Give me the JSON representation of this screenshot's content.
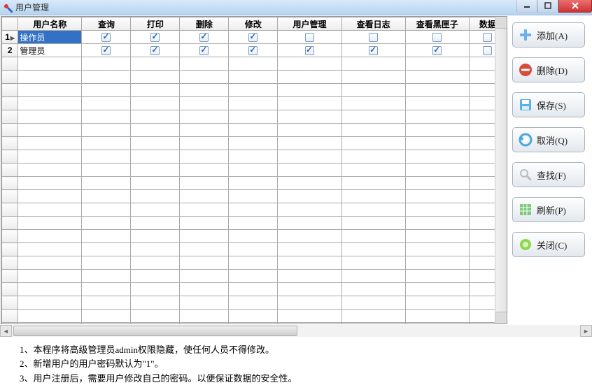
{
  "window": {
    "title": "用户管理"
  },
  "columns": [
    "用户名称",
    "查询",
    "打印",
    "删除",
    "修改",
    "用户管理",
    "查看日志",
    "查看黑匣子",
    "数据"
  ],
  "rows": [
    {
      "num": "1",
      "name": "操作员",
      "selected": true,
      "checks": {
        "查询": true,
        "打印": true,
        "删除": true,
        "修改": true,
        "用户管理": false,
        "查看日志": false,
        "查看黑匣子": false,
        "数据": false
      }
    },
    {
      "num": "2",
      "name": "管理员",
      "selected": false,
      "checks": {
        "查询": true,
        "打印": true,
        "删除": true,
        "修改": true,
        "用户管理": true,
        "查看日志": true,
        "查看黑匣子": true,
        "数据": false
      }
    }
  ],
  "buttons": {
    "add": "添加(A)",
    "delete": "删除(D)",
    "save": "保存(S)",
    "cancel": "取消(Q)",
    "find": "查找(F)",
    "refresh": "刷新(P)",
    "close": "关闭(C)"
  },
  "notes": {
    "n1": "1、本程序将高级管理员admin权限隐藏，使任何人员不得修改。",
    "n2": "2、新增用户的用户密码默认为\"1\"。",
    "n3": "3、用户注册后，需要用户修改自己的密码。以便保证数据的安全性。"
  }
}
